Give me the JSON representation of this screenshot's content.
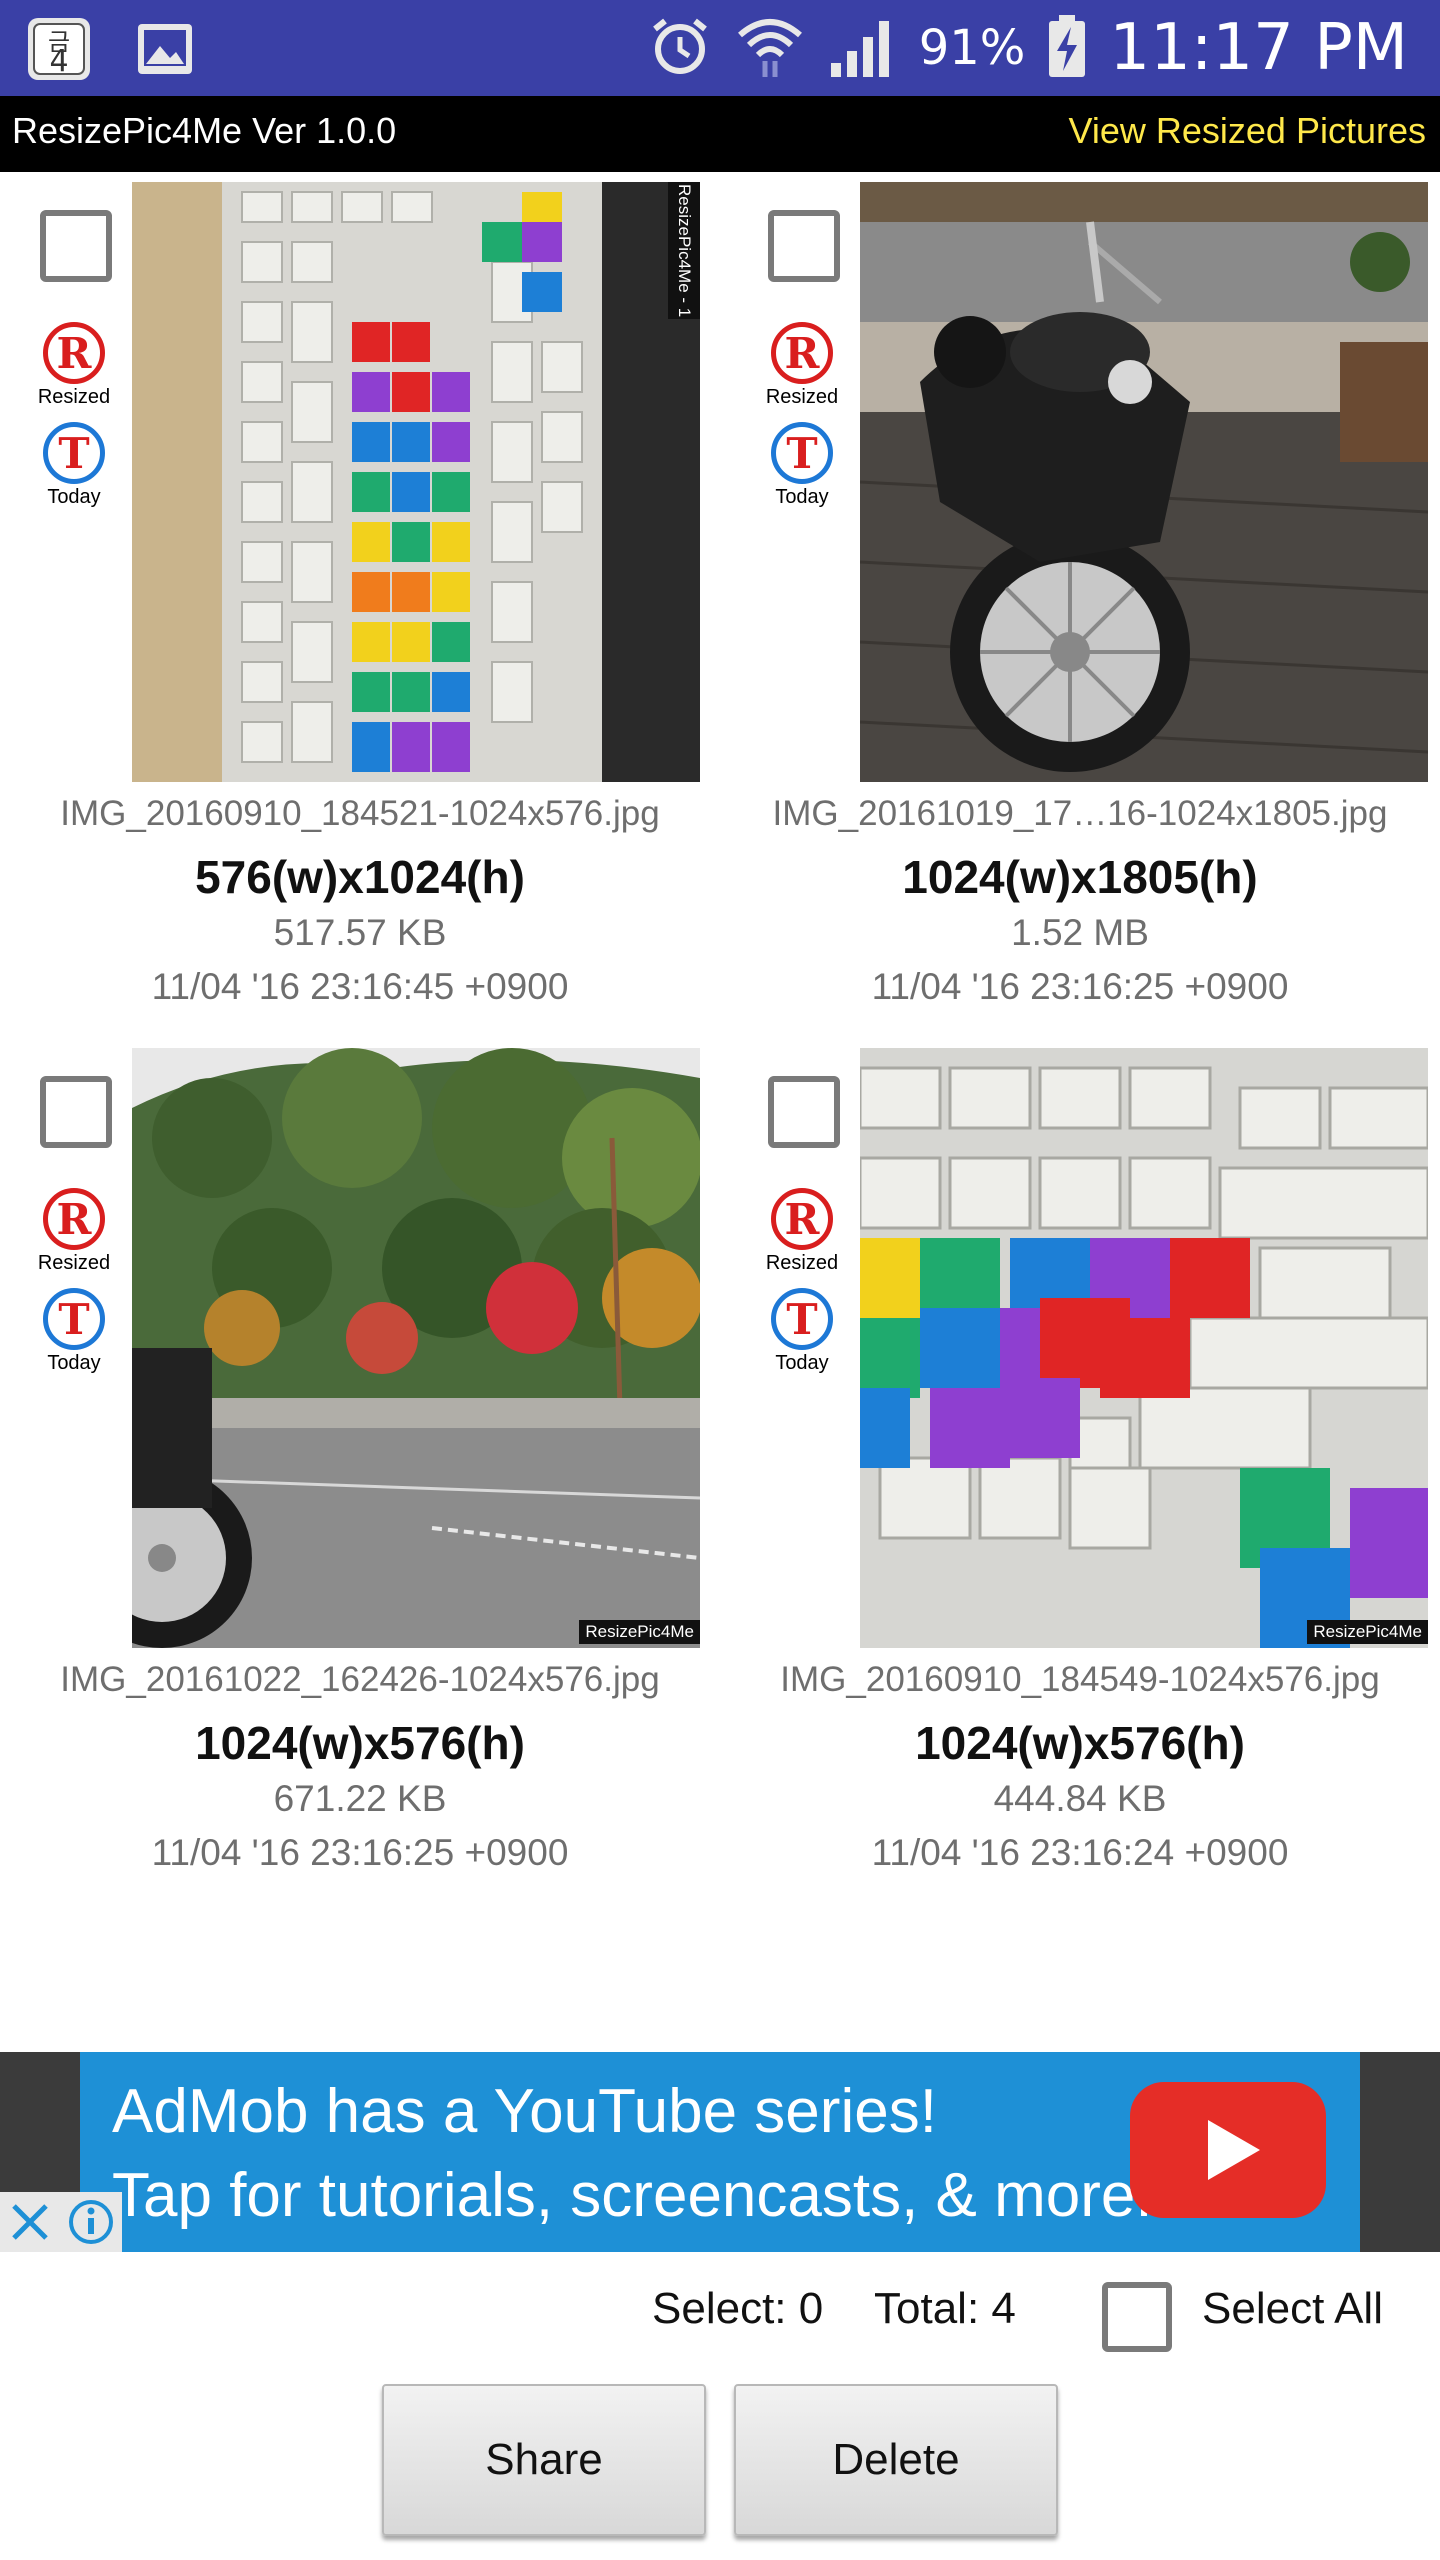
{
  "status_bar": {
    "battery": "91%",
    "time": "11:17 PM",
    "left_badge_glyph": "4",
    "left_badge_glyph_top": "금",
    "icons": [
      "calendar-day-icon",
      "image-icon",
      "alarm-icon",
      "wifi-icon",
      "signal-icon",
      "battery-charging-icon"
    ]
  },
  "app_bar": {
    "title": "ResizePic4Me Ver 1.0.0",
    "link": "View Resized Pictures",
    "link_color": "#ffe84a"
  },
  "badges": {
    "resized_glyph": "R",
    "resized_label": "Resized",
    "today_glyph": "T",
    "today_label": "Today"
  },
  "pictures": [
    {
      "filename": "IMG_20160910_184521-1024x576.jpg",
      "dimensions": "576(w)x1024(h)",
      "size": "517.57 KB",
      "date": "11/04 '16 23:16:45 +0900",
      "watermark": "ResizePic4Me - 1",
      "thumbnail": "keyboard-portrait"
    },
    {
      "filename": "IMG_20161019_17…16-1024x1805.jpg",
      "dimensions": "1024(w)x1805(h)",
      "size": "1.52 MB",
      "date": "11/04 '16 23:16:25 +0900",
      "thumbnail": "motorcycle"
    },
    {
      "filename": "IMG_20161022_162426-1024x576.jpg",
      "dimensions": "1024(w)x576(h)",
      "size": "671.22 KB",
      "date": "11/04 '16 23:16:25 +0900",
      "watermark": "ResizePic4Me",
      "thumbnail": "trees-road"
    },
    {
      "filename": "IMG_20160910_184549-1024x576.jpg",
      "dimensions": "1024(w)x576(h)",
      "size": "444.84 KB",
      "date": "11/04 '16 23:16:24 +0900",
      "watermark": "ResizePic4Me",
      "thumbnail": "keyboard-closeup"
    }
  ],
  "ad": {
    "line1": "AdMob has a YouTube series!",
    "line2": "Tap for tutorials, screencasts, & more.",
    "close_glyph": "✕",
    "info_glyph": "ⓘ"
  },
  "footer": {
    "select_label": "Select: 0",
    "total_label": "Total: 4",
    "select_all_label": "Select All",
    "share_label": "Share",
    "delete_label": "Delete"
  },
  "colors": {
    "status_bar": "#3a40a6",
    "app_bar": "#000000",
    "ad_background": "#1e90d6",
    "badge_red": "#d91e1e",
    "badge_blue": "#1d78d6"
  }
}
